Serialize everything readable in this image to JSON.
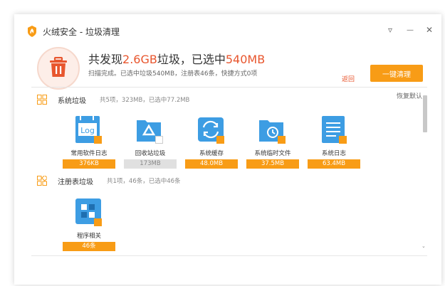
{
  "window": {
    "title": "火绒安全 - 垃圾清理",
    "controls": {
      "menu": "▿",
      "minimize": "—",
      "maximize": "☐",
      "close": "✕"
    }
  },
  "summary": {
    "headline_prefix": "共发现",
    "found_size": "2.6GB",
    "headline_middle": "垃圾，已选中",
    "selected_size": "540MB",
    "subline": "扫描完成。已选中垃圾540MB，注册表46条，快捷方式0项",
    "back_link": "返回",
    "clean_button": "一键清理",
    "restore_default": "恢复默认"
  },
  "sections": [
    {
      "title": "系统垃圾",
      "desc": "共5项，323MB，已选中77.2MB",
      "items": [
        {
          "label": "常用软件日志",
          "size": "376KB",
          "checked": true,
          "icon": "log-file-icon"
        },
        {
          "label": "回收站垃圾",
          "size": "173MB",
          "checked": false,
          "icon": "recycle-bin-icon"
        },
        {
          "label": "系统缓存",
          "size": "48.0MB",
          "checked": true,
          "icon": "system-cache-icon"
        },
        {
          "label": "系统临时文件",
          "size": "37.5MB",
          "checked": true,
          "icon": "temp-folder-icon"
        },
        {
          "label": "系统日志",
          "size": "63.4MB",
          "checked": true,
          "icon": "system-log-icon"
        }
      ]
    },
    {
      "title": "注册表垃圾",
      "desc": "共1项，46条，已选中46条",
      "items": [
        {
          "label": "程序相关",
          "size": "46条",
          "checked": true,
          "icon": "program-registry-icon"
        }
      ]
    }
  ],
  "colors": {
    "accent": "#f89c16",
    "highlight": "#e8562e",
    "icon_blue": "#3d9de3"
  }
}
